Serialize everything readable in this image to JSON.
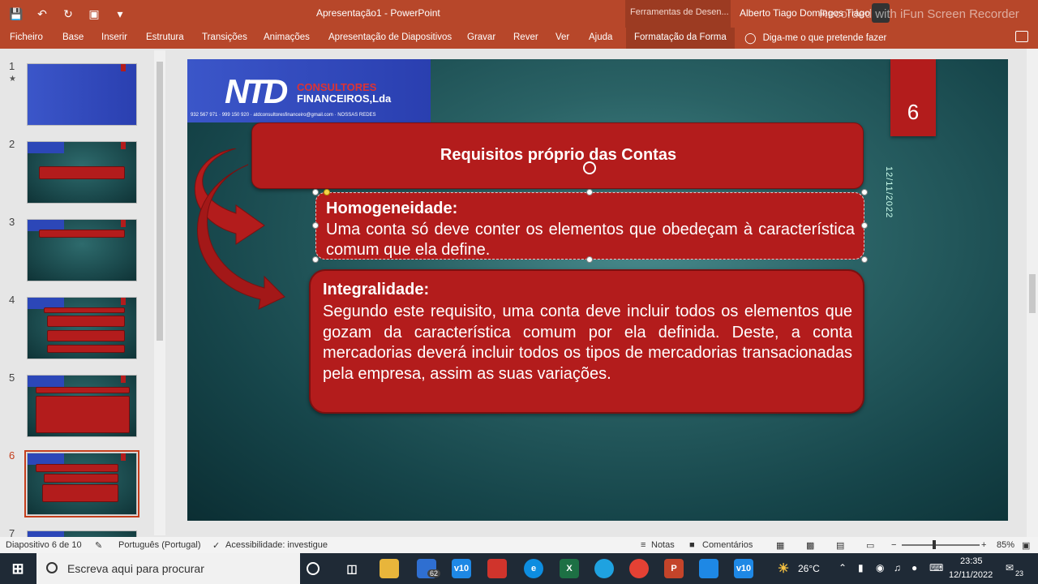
{
  "window": {
    "title": "Apresentação1 - PowerPoint",
    "context_tools": "Ferramentas de Desen...",
    "user": "Alberto Tiago Domingos Tiago",
    "watermark": "Recorded with iFun Screen Recorder"
  },
  "ribbon": {
    "tabs": [
      "Ficheiro",
      "Base",
      "Inserir",
      "Estrutura",
      "Transições",
      "Animações",
      "Apresentação de Diapositivos",
      "Gravar",
      "Rever",
      "Ver",
      "Ajuda"
    ],
    "context_tab": "Formatação da Forma",
    "tell_me": "Diga-me o que pretende fazer"
  },
  "thumbnails": {
    "numbers": [
      "1",
      "2",
      "3",
      "4",
      "5",
      "6",
      "7"
    ],
    "active": "6"
  },
  "slide": {
    "logo_main": "NTD",
    "logo_line1": "CONSULTORES",
    "logo_line2": "FINANCEIROS,Lda",
    "logo_contact": "932 567 971 · 999 150 920 · atdconsultoresfinanceiro@gmail.com · NOSSAS REDES",
    "number": "6",
    "date": "12/11/2022",
    "title": "Requisitos próprio das Contas",
    "box1_heading": "Homogeneidade:",
    "box1_body": " Uma conta só deve conter os elementos que obedeçam à característica comum que ela define.",
    "box2_heading": "Integralidade:",
    "box2_body": "Segundo este requisito, uma conta deve incluir todos os elementos que gozam da característica comum por ela definida. Deste, a conta mercadorias deverá incluir todos os tipos de mercadorias transacionadas pela empresa, assim as suas variações."
  },
  "status": {
    "slide_count": "Diapositivo 6 de 10",
    "language": "Português (Portugal)",
    "accessibility": "Acessibilidade: investigue",
    "notes": "Notas",
    "comments": "Comentários",
    "zoom": "85%"
  },
  "taskbar": {
    "search_placeholder": "Escreva aqui para procurar",
    "mail_badge": "62",
    "weather": "26°C",
    "time": "23:35",
    "date": "12/11/2022",
    "notif_count": "23"
  }
}
